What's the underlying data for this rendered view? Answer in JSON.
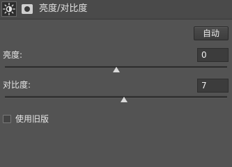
{
  "header": {
    "title": "亮度/对比度",
    "adjustment_icon": "sun-brightness-icon",
    "mask_icon": "layer-mask-icon"
  },
  "auto_button": {
    "label": "自动"
  },
  "brightness": {
    "label": "亮度:",
    "value": "0",
    "slider_fraction": 0.5
  },
  "contrast": {
    "label": "对比度:",
    "value": "7",
    "slider_fraction": 0.535
  },
  "legacy": {
    "label": "使用旧版",
    "checked": false
  },
  "colors": {
    "panel_bg": "#535353",
    "header_bg": "#4a4a4a",
    "text": "#e6e6e6",
    "field_bg": "#3c3c3c"
  }
}
